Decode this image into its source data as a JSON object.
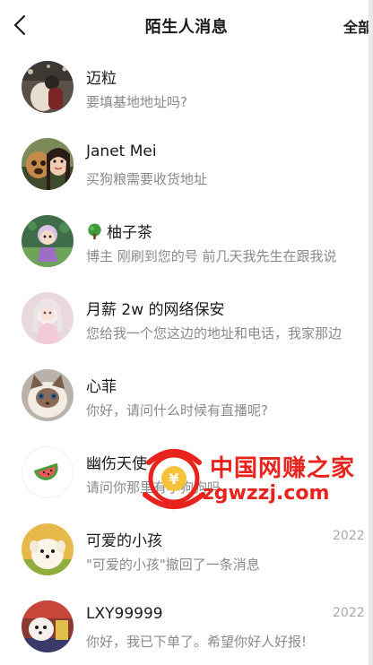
{
  "header": {
    "title": "陌生人消息",
    "action": "全部已读"
  },
  "messages": [
    {
      "name": "迈粒",
      "preview": "要填基地地址吗?",
      "time": ""
    },
    {
      "name": "Janet Mei",
      "preview": "买狗粮需要收货地址",
      "time": ""
    },
    {
      "name": "柚子茶",
      "preview": "博主 刚刷到您的号 前几天我先生在跟我说",
      "time": ""
    },
    {
      "name": "月薪 2w 的网络保安",
      "preview": "您给我一个您这边的地址和电话，我家那边",
      "time": ""
    },
    {
      "name": "心菲",
      "preview": "你好，请问什么时候有直播呢?",
      "time": ""
    },
    {
      "name": "幽伤天使",
      "preview": "请问你那里有小狗狗吗",
      "time": ""
    },
    {
      "name": "可爱的小孩",
      "preview": "\"可爱的小孩\"撤回了一条消息",
      "time": "2022"
    },
    {
      "name": "LXY99999",
      "preview": "你好，我已下单了。希望你好人好报!",
      "time": "2022"
    }
  ],
  "watermark": {
    "title": "中国网赚之家",
    "url": "zgwzzj.com"
  }
}
